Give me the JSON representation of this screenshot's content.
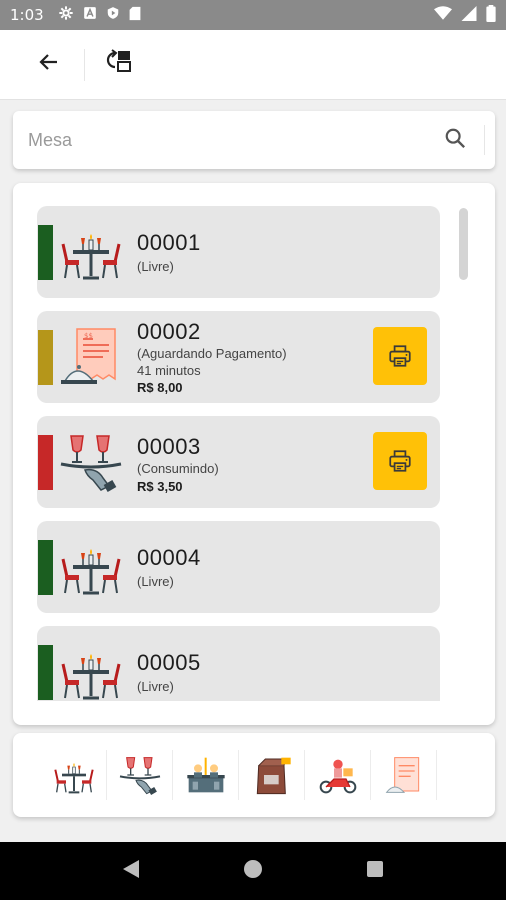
{
  "status_bar": {
    "time": "1:03",
    "left_icons": [
      "gear-icon",
      "a-icon",
      "play-shield-icon",
      "sd-card-icon"
    ],
    "right_icons": [
      "wifi-icon",
      "signal-icon",
      "battery-icon"
    ]
  },
  "app_bar": {
    "back_icon": "arrow-back-icon",
    "action_icon": "swap-table-icon"
  },
  "search": {
    "placeholder": "Mesa",
    "icon": "search-icon"
  },
  "tables": [
    {
      "number": "00001",
      "status": "(Livre)",
      "minutes": "",
      "value": "",
      "status_color": "#1b5e20",
      "illustration": "table-chairs-icon",
      "has_print": false
    },
    {
      "number": "00002",
      "status": "(Aguardando Pagamento)",
      "minutes": "41 minutos",
      "value": "R$ 8,00",
      "status_color": "#b5961a",
      "illustration": "bill-cloche-icon",
      "has_print": true
    },
    {
      "number": "00003",
      "status": "(Consumindo)",
      "minutes": "",
      "value": "R$ 3,50",
      "status_color": "#c62828",
      "illustration": "tray-glasses-icon",
      "has_print": true
    },
    {
      "number": "00004",
      "status": "(Livre)",
      "minutes": "",
      "value": "",
      "status_color": "#1b5e20",
      "illustration": "table-chairs-icon",
      "has_print": false
    },
    {
      "number": "00005",
      "status": "(Livre)",
      "minutes": "",
      "value": "",
      "status_color": "#1b5e20",
      "illustration": "table-chairs-icon",
      "has_print": false
    }
  ],
  "print_icon": "printer-icon",
  "bottom_bar": [
    "table-chairs-icon",
    "tray-glasses-icon",
    "counter-icon",
    "takeaway-bag-icon",
    "delivery-scooter-icon",
    "bill-icon"
  ],
  "colors": {
    "accent": "#ffc107",
    "card_bg": "#e6e6e6",
    "free": "#1b5e20",
    "awaiting_payment": "#b5961a",
    "consuming": "#c62828"
  },
  "nav_bar": [
    "back-triangle-icon",
    "home-circle-icon",
    "recents-square-icon"
  ]
}
